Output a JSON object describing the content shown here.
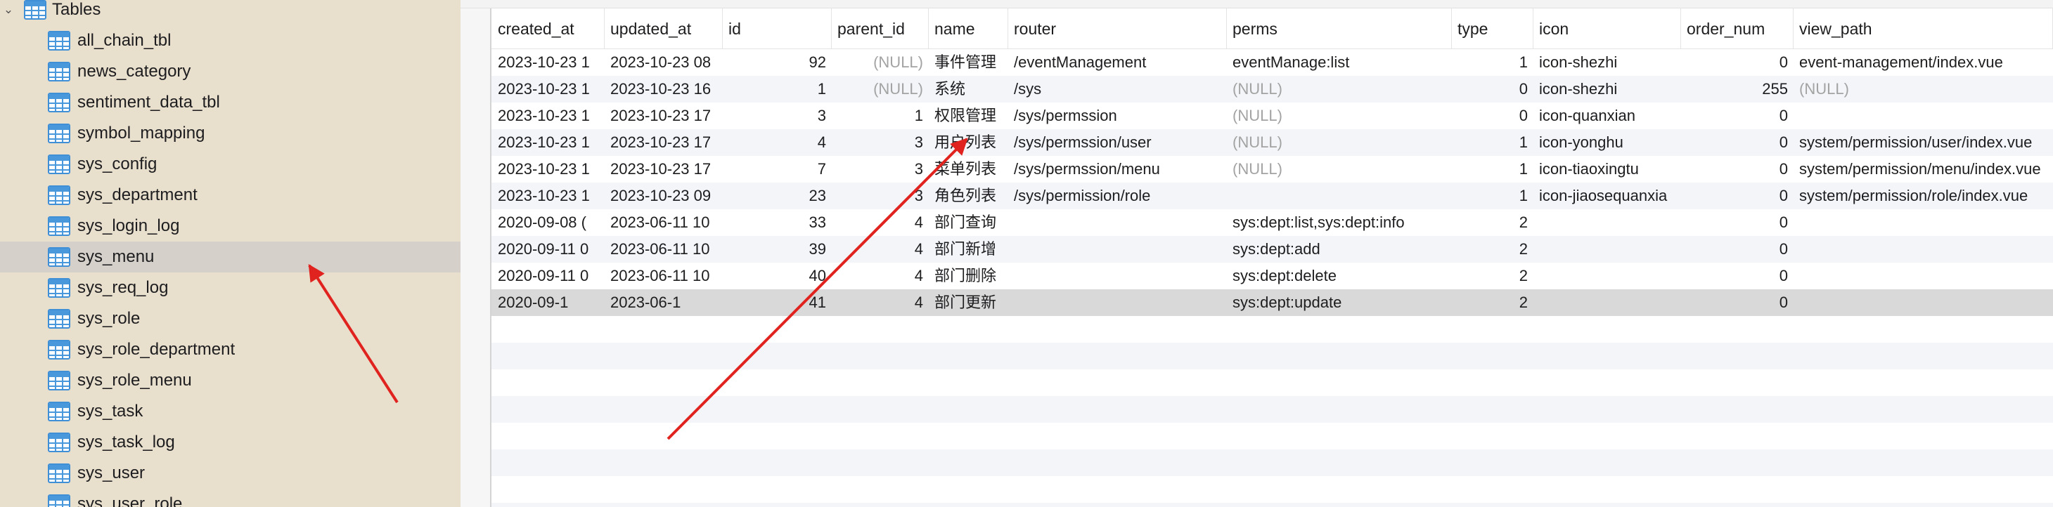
{
  "sidebar": {
    "section_label": "Tables",
    "items": [
      {
        "label": "all_chain_tbl"
      },
      {
        "label": "news_category"
      },
      {
        "label": "sentiment_data_tbl"
      },
      {
        "label": "symbol_mapping"
      },
      {
        "label": "sys_config"
      },
      {
        "label": "sys_department"
      },
      {
        "label": "sys_login_log"
      },
      {
        "label": "sys_menu",
        "selected": true
      },
      {
        "label": "sys_req_log"
      },
      {
        "label": "sys_role"
      },
      {
        "label": "sys_role_department"
      },
      {
        "label": "sys_role_menu"
      },
      {
        "label": "sys_task"
      },
      {
        "label": "sys_task_log"
      },
      {
        "label": "sys_user"
      },
      {
        "label": "sys_user_role"
      }
    ]
  },
  "grid": {
    "columns": [
      {
        "key": "created_at",
        "label": "created_at"
      },
      {
        "key": "updated_at",
        "label": "updated_at"
      },
      {
        "key": "id",
        "label": "id"
      },
      {
        "key": "parent_id",
        "label": "parent_id"
      },
      {
        "key": "name",
        "label": "name"
      },
      {
        "key": "router",
        "label": "router"
      },
      {
        "key": "perms",
        "label": "perms"
      },
      {
        "key": "type",
        "label": "type"
      },
      {
        "key": "icon",
        "label": "icon"
      },
      {
        "key": "order_num",
        "label": "order_num"
      },
      {
        "key": "view_path",
        "label": "view_path"
      }
    ],
    "rows": [
      {
        "created_at": "2023-10-23 1",
        "updated_at": "2023-10-23 08",
        "id": "92",
        "parent_id": "(NULL)",
        "name": "事件管理",
        "router": "/eventManagement",
        "perms": "eventManage:list",
        "type": "1",
        "icon": "icon-shezhi",
        "order_num": "0",
        "view_path": "event-management/index.vue"
      },
      {
        "created_at": "2023-10-23 1",
        "updated_at": "2023-10-23 16",
        "id": "1",
        "parent_id": "(NULL)",
        "name": "系统",
        "router": "/sys",
        "perms": "(NULL)",
        "type": "0",
        "icon": "icon-shezhi",
        "order_num": "255",
        "view_path": "(NULL)"
      },
      {
        "created_at": "2023-10-23 1",
        "updated_at": "2023-10-23 17",
        "id": "3",
        "parent_id": "1",
        "name": "权限管理",
        "router": "/sys/permssion",
        "perms": "(NULL)",
        "type": "0",
        "icon": "icon-quanxian",
        "order_num": "0",
        "view_path": ""
      },
      {
        "created_at": "2023-10-23 1",
        "updated_at": "2023-10-23 17",
        "id": "4",
        "parent_id": "3",
        "name": "用户列表",
        "router": "/sys/permssion/user",
        "perms": "(NULL)",
        "type": "1",
        "icon": "icon-yonghu",
        "order_num": "0",
        "view_path": "system/permission/user/index.vue"
      },
      {
        "created_at": "2023-10-23 1",
        "updated_at": "2023-10-23 17",
        "id": "7",
        "parent_id": "3",
        "name": "菜单列表",
        "router": "/sys/permssion/menu",
        "perms": "(NULL)",
        "type": "1",
        "icon": "icon-tiaoxingtu",
        "order_num": "0",
        "view_path": "system/permission/menu/index.vue"
      },
      {
        "created_at": "2023-10-23 1",
        "updated_at": "2023-10-23 09",
        "id": "23",
        "parent_id": "3",
        "name": "角色列表",
        "router": "/sys/permission/role",
        "perms": "",
        "type": "1",
        "icon": "icon-jiaosequanxia",
        "order_num": "0",
        "view_path": "system/permission/role/index.vue"
      },
      {
        "created_at": "2020-09-08 (",
        "updated_at": "2023-06-11 10",
        "id": "33",
        "parent_id": "4",
        "name": "部门查询",
        "router": "",
        "perms": "sys:dept:list,sys:dept:info",
        "type": "2",
        "icon": "",
        "order_num": "0",
        "view_path": ""
      },
      {
        "created_at": "2020-09-11 0",
        "updated_at": "2023-06-11 10",
        "id": "39",
        "parent_id": "4",
        "name": "部门新增",
        "router": "",
        "perms": "sys:dept:add",
        "type": "2",
        "icon": "",
        "order_num": "0",
        "view_path": ""
      },
      {
        "created_at": "2020-09-11 0",
        "updated_at": "2023-06-11 10",
        "id": "40",
        "parent_id": "4",
        "name": "部门删除",
        "router": "",
        "perms": "sys:dept:delete",
        "type": "2",
        "icon": "",
        "order_num": "0",
        "view_path": ""
      },
      {
        "created_at": "2020-09-1",
        "updated_at": "2023-06-1",
        "id": "41",
        "parent_id": "4",
        "name": "部门更新",
        "router": "",
        "perms": "sys:dept:update",
        "type": "2",
        "icon": "",
        "order_num": "0",
        "view_path": "",
        "selected": true
      }
    ],
    "row_marker": "▸"
  },
  "annotations": {
    "arrow_color": "#e0231e"
  }
}
